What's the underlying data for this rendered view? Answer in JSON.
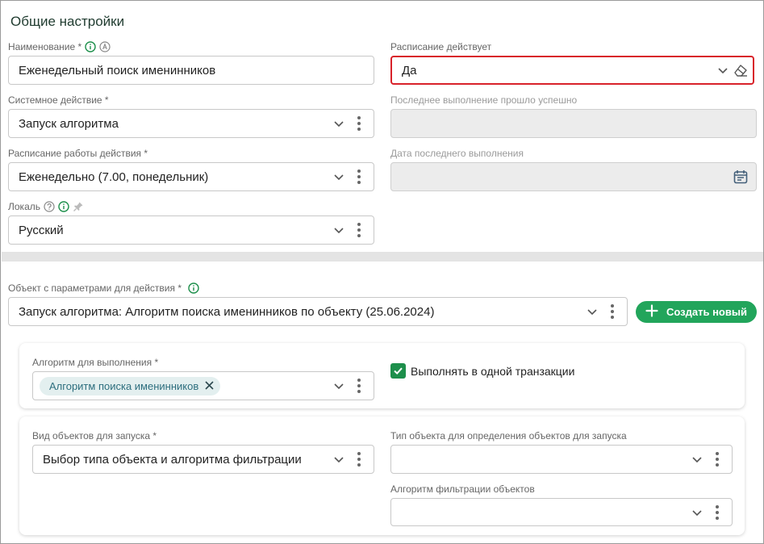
{
  "section_title": "Общие настройки",
  "name": {
    "label": "Наименование *",
    "value": "Еженедельный поиск именинников"
  },
  "schedule_active": {
    "label": "Расписание действует",
    "value": "Да"
  },
  "system_action": {
    "label": "Системное действие *",
    "value": "Запуск алгоритма"
  },
  "last_run_success": {
    "label": "Последнее выполнение прошло успешно",
    "value": ""
  },
  "action_schedule": {
    "label": "Расписание работы действия *",
    "value": "Еженедельно (7.00, понедельник)"
  },
  "last_run_date": {
    "label": "Дата последнего выполнения",
    "value": ""
  },
  "locale": {
    "label": "Локаль",
    "value": "Русский"
  },
  "params_object": {
    "label": "Объект с параметрами для действия *",
    "value": "Запуск алгоритма: Алгоритм поиска именинников по объекту (25.06.2024)"
  },
  "create_button": {
    "label": "Создать новый",
    "icon": "plus-icon"
  },
  "algorithm": {
    "label": "Алгоритм для выполнения *",
    "chip": "Алгоритм поиска именинников"
  },
  "single_transaction": {
    "label": "Выполнять в одной транзакции",
    "checked": true
  },
  "objects_kind": {
    "label": "Вид объектов для запуска *",
    "value": "Выбор типа объекта и алгоритма фильтрации"
  },
  "object_type": {
    "label": "Тип объекта для определения объектов для запуска",
    "value": ""
  },
  "filter_algorithm": {
    "label": "Алгоритм фильтрации объектов",
    "value": ""
  },
  "colors": {
    "accent_green": "#22a55b",
    "active_border": "#d8222a",
    "chip_bg": "#e3efef",
    "chip_text": "#2d6e7e"
  }
}
